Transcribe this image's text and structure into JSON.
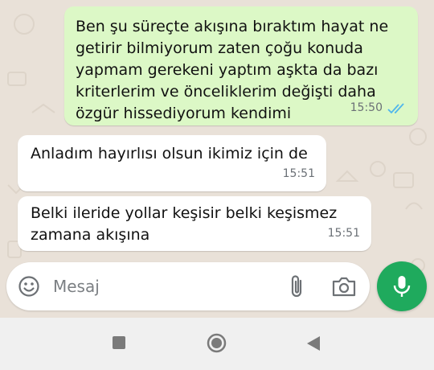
{
  "messages": [
    {
      "direction": "outgoing",
      "text": "Ben şu süreçte akışına bıraktım hayat ne getirir bilmiyorum zaten çoğu konuda yapmam gerekeni yaptım aşkta da bazı kriterlerim ve önceliklerim değişti daha özgür hissediyorum kendimi",
      "time": "15:50",
      "status": "read"
    },
    {
      "direction": "incoming",
      "text": "Anladım hayırlısı olsun ikimiz için de",
      "time": "15:51"
    },
    {
      "direction": "incoming",
      "text": "Belki ileride yollar keşisir belki keşismez zamana akışına",
      "time": "15:51"
    }
  ],
  "composer": {
    "placeholder": "Mesaj"
  },
  "colors": {
    "outgoing_bubble": "#dcf8c6",
    "incoming_bubble": "#ffffff",
    "mic_button": "#1faa5d",
    "read_ticks": "#4fb6ec"
  },
  "icons": {
    "emoji": "emoji-icon",
    "attach": "paperclip-icon",
    "camera": "camera-icon",
    "mic": "microphone-icon",
    "nav_recents": "square-icon",
    "nav_home": "circle-icon",
    "nav_back": "triangle-back-icon"
  }
}
